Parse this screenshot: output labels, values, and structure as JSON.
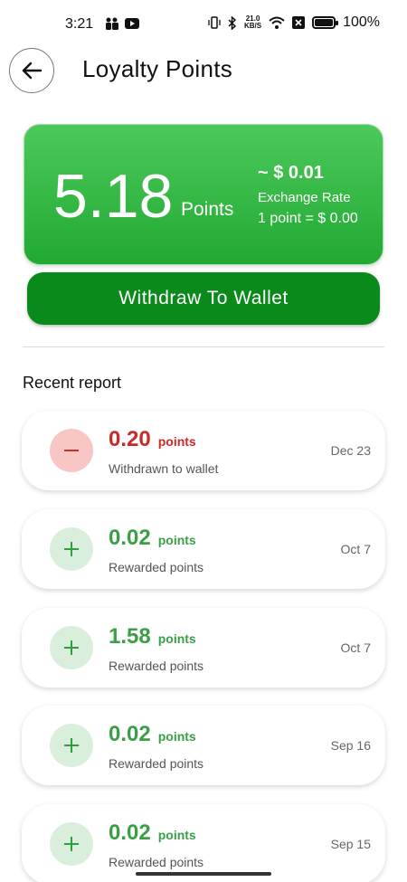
{
  "status_bar": {
    "time": "3:21",
    "network_speed_top": "21.0",
    "network_speed_bottom": "KB/S",
    "battery": "100%",
    "battery_level": 1.0
  },
  "header": {
    "back_icon": "arrow-left-icon",
    "title": "Loyalty Points"
  },
  "points_card": {
    "value": "5.18",
    "unit": "Points",
    "approx": "~ $ 0.01",
    "rate_label": "Exchange Rate",
    "rate_value": "1 point = $ 0.00",
    "color_top": "#4cc95a",
    "color_bottom": "#22a933"
  },
  "withdraw_button": {
    "label": "Withdraw To Wallet",
    "color": "#0b8a1c"
  },
  "recent": {
    "title": "Recent report",
    "items": [
      {
        "type": "negative",
        "icon": "minus-icon",
        "amount": "0.20",
        "unit": "points",
        "description": "Withdrawn to wallet",
        "date": "Dec 23"
      },
      {
        "type": "positive",
        "icon": "plus-icon",
        "amount": "0.02",
        "unit": "points",
        "description": "Rewarded points",
        "date": "Oct 7"
      },
      {
        "type": "positive",
        "icon": "plus-icon",
        "amount": "1.58",
        "unit": "points",
        "description": "Rewarded points",
        "date": "Oct 7"
      },
      {
        "type": "positive",
        "icon": "plus-icon",
        "amount": "0.02",
        "unit": "points",
        "description": "Rewarded points",
        "date": "Sep 16"
      },
      {
        "type": "positive",
        "icon": "plus-icon",
        "amount": "0.02",
        "unit": "points",
        "description": "Rewarded points",
        "date": "Sep 15"
      }
    ]
  }
}
